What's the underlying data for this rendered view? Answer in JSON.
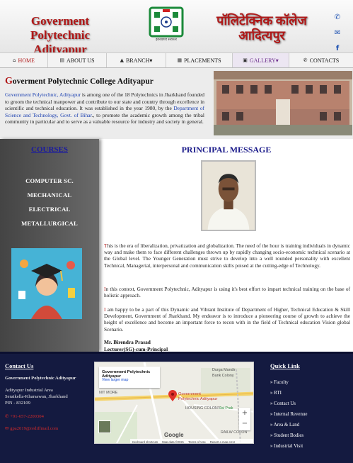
{
  "header": {
    "title_en": "Goverment Polytechnic Adityapur",
    "title_hi": "पॉलिटेक्निक कॉलेज आदित्यपुर",
    "logo_caption": "झारखण्ड सरकार",
    "social": [
      {
        "icon": "phone-icon",
        "glyph": "✆"
      },
      {
        "icon": "mail-icon",
        "glyph": "✉"
      },
      {
        "icon": "facebook-icon",
        "glyph": "f"
      }
    ]
  },
  "nav": [
    {
      "label": "HOME",
      "icon": "home-icon",
      "glyph": "⌂"
    },
    {
      "label": "ABOUT US",
      "icon": "book-icon",
      "glyph": "▤"
    },
    {
      "label": "BRANCH",
      "icon": "graduation-cap-icon",
      "glyph": "▲",
      "caret": "▾"
    },
    {
      "label": "PLACEMENTS",
      "icon": "chart-icon",
      "glyph": "▦"
    },
    {
      "label": "GALLERY",
      "icon": "image-icon",
      "glyph": "▣",
      "caret": "▾"
    },
    {
      "label": "CONTACTS",
      "icon": "phone-icon",
      "glyph": "✆"
    }
  ],
  "intro": {
    "heading_first": "G",
    "heading_rest": "overment Polytechnic College Adityapur",
    "p_link1": "Government Polytechnic, Adityapur",
    "p_text1": " is among one of the 18 Polytechnics in Jharkhand founded to groom the technical manpower and contribute to our state and country through excellence in scientific and technical education. It was established in the year 1980, by the ",
    "p_link2": "Department of Science and Technology, Govt. of Bihar",
    "p_text2": "., to promote the academic growth among the tribal community in particular and to serve as a valuable resource for industry and society in general."
  },
  "courses": {
    "heading": "COURSES",
    "items": [
      "COMPUTER SC.",
      "MECHANICAL",
      "ELECTRICAL",
      "METALLURGICAL"
    ]
  },
  "principal": {
    "heading": "PRINCIPAL MESSAGE",
    "p1_first": "T",
    "p1": "his is the era of liberalization, privatization and globalization. The need of the hour is training individuals in dynamic way and make them to face different challenges thrown up by rapidly changing socio-economic technical scenario at the Global level. The Younger Generation must strive to develop into a well rounded personality with excellent Technical, Managerial, interpersonal and communication skills poised at the cutting-edge of Technology.",
    "p2_first": "I",
    "p2": "n this context, Government Polytechnic, Adityapur is using it's best effort to impart technical training on the base of holistic approach.",
    "p3_first": "I",
    "p3": " am happy to be a part of this Dynamic and Vibrant Institute of Department of Higher, Technical Education & Skill Development, Government of Jharkhand. My endeavor is to introduce a pioneering course of growth to achieve the height of excellence and become an important force to recon with in the field of Technical education Vision global Scenario.",
    "sig_name": "Mr. Birendra Prasad",
    "sig_title": "Lecturer(SG)-cum-Principal"
  },
  "footer": {
    "contact_heading": "Contact   Us",
    "name": "Government Polytechnic Adityapur",
    "addr1": "Adityapur Industrial Area",
    "addr2": "Seraikella-Kharsawan, Jharkhand",
    "pin": "PIN - 832109",
    "phone": "+91-657-2200304",
    "email": "gpa2019@rediffmail.com",
    "map": {
      "title": "Government Polytechnic Adityapur",
      "link": "View larger map",
      "pin_label": "Government Polytechnic Adityapur",
      "labels": [
        "Durga Mandir",
        "Bank Colony",
        "NIT MORE",
        "HOUSING COLONY",
        "Jai Prak",
        "RAILW COLON"
      ],
      "footer_links": [
        "Keyboard shortcuts",
        "Map data ©2021",
        "Terms of Use",
        "Report a map error"
      ],
      "brand": "Google"
    },
    "quick_heading": "Quick Link",
    "quick_links": [
      "Faculty",
      "RTI",
      "Contact Us",
      "Internal Revenue",
      "Area & Land",
      "Student Bodies",
      "Industrial Visit"
    ]
  },
  "colors": {
    "accent_red": "#b01818",
    "link_blue": "#1a3fb0",
    "footer_bg": "#141a40",
    "heading_blue": "#1a1a8a"
  }
}
